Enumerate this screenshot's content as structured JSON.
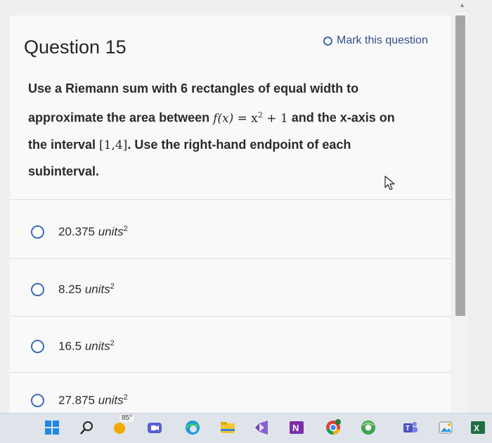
{
  "question": {
    "title": "Question 15",
    "mark_label": "Mark this question",
    "text_line1": "Use a Riemann sum with 6 rectangles of equal width to",
    "text_line2_pre": "approximate the area between ",
    "function_lhs": "f(x)",
    "function_eq": " = x",
    "function_exp": "2",
    "function_tail": " + 1",
    "text_line2_post": " and the x-axis on",
    "text_line3_pre": "the interval ",
    "interval": "[1,4]",
    "text_line3_post": ". Use the right-hand endpoint of each",
    "text_line4": "subinterval."
  },
  "options": [
    {
      "value": "20.375",
      "units": "units",
      "exp": "2"
    },
    {
      "value": "8.25",
      "units": "units",
      "exp": "2"
    },
    {
      "value": "16.5",
      "units": "units",
      "exp": "2"
    },
    {
      "value": "27.875",
      "units": "units",
      "exp": "2"
    }
  ],
  "taskbar": {
    "weather_temp": "85°",
    "icons": [
      "windows-start-icon",
      "search-icon",
      "weather-icon",
      "video-call-icon",
      "edge-browser-icon",
      "file-explorer-icon",
      "visual-studio-icon",
      "onenote-icon",
      "chrome-icon",
      "chrome-canary-icon",
      "teams-icon",
      "photos-icon",
      "excel-icon"
    ]
  },
  "colors": {
    "accent": "#3b6db4",
    "link": "#2f4f8c",
    "background": "#f9f9f9"
  }
}
